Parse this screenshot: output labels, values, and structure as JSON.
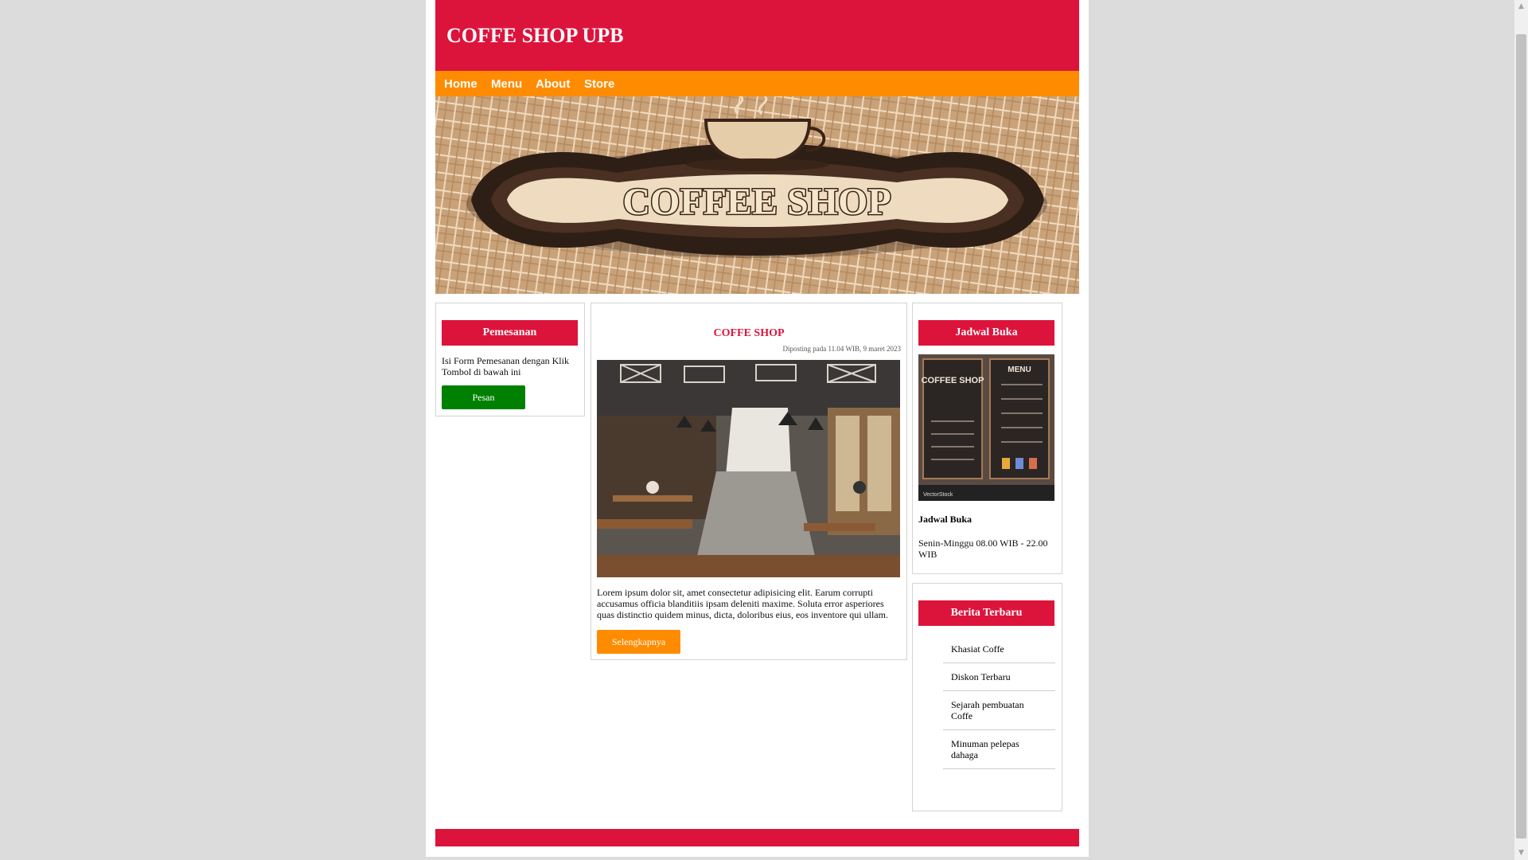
{
  "site": {
    "title": "COFFE SHOP UPB"
  },
  "nav": [
    "Home",
    "Menu",
    "About",
    "Store"
  ],
  "banner": {
    "logo_text": "COFFEE SHOP"
  },
  "order": {
    "heading": "Pemesanan",
    "description": "Isi Form Pemesanan dengan Klik Tombol di bawah ini",
    "button": "Pesan"
  },
  "article": {
    "title": "COFFE SHOP",
    "posted": "Diposting pada 11.04 WIB, 9 maret 2023",
    "body": "Lorem ipsum dolor sit, amet consectetur adipisicing elit. Earum corrupti accusamus officia blanditiis ipsam deleniti maxime. Soluta error asperiores quas distinctio quidem minus, dicta, doloribus eius, eos inventore qui ullam.",
    "button": "Selengkapnya"
  },
  "schedule": {
    "heading": "Jadwal Buka",
    "board_left_title": "COFFEE SHOP",
    "board_right_title": "MENU",
    "board_credit": "VectorStock",
    "subheading": "Jadwal Buka",
    "hours": "Senin-Minggu 08.00 WIB - 22.00 WIB"
  },
  "news": {
    "heading": "Berita Terbaru",
    "items": [
      "Khasiat Coffe",
      "Diskon Terbaru",
      "Sejarah pembuatan Coffe",
      "Minuman pelepas dahaga"
    ]
  },
  "colors": {
    "primary": "#dc143c",
    "accent": "#ff8c00",
    "order_button": "#008000",
    "page_background": "#dcdcdc"
  }
}
